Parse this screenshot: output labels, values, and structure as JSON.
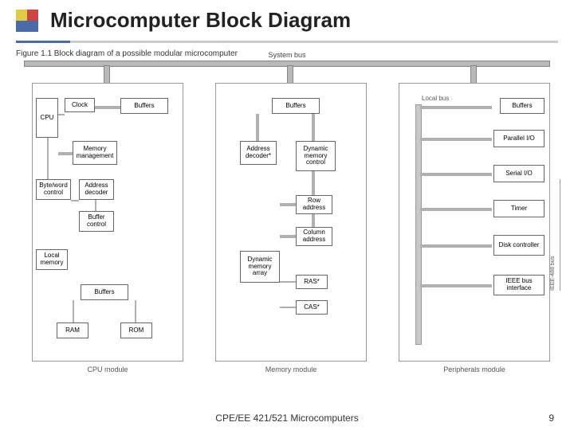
{
  "title": "Microcomputer Block Diagram",
  "figure_caption": "Figure 1.1  Block diagram of a possible modular microcomputer",
  "system_bus_label": "System bus",
  "modules": {
    "cpu": {
      "label": "CPU module",
      "blocks": {
        "cpu": "CPU",
        "clock": "Clock",
        "buffers_top": "Buffers",
        "mem_mgmt": "Memory management",
        "byteword": "Byte/word control",
        "addr_dec": "Address decoder",
        "buf_ctrl": "Buffer control",
        "local_mem": "Local memory",
        "buffers_bot": "Buffers",
        "ram": "RAM",
        "rom": "ROM"
      }
    },
    "memory": {
      "label": "Memory module",
      "blocks": {
        "buffers": "Buffers",
        "addr_dec": "Address decoder*",
        "dyn_ctrl": "Dynamic memory control",
        "row_addr": "Row address",
        "col_addr": "Column address",
        "dyn_array": "Dynamic memory array",
        "ras": "RAS*",
        "cas": "CAS*"
      }
    },
    "periph": {
      "label": "Peripherals module",
      "local_bus": "Local bus",
      "blocks": {
        "buffers": "Buffers",
        "pio": "Parallel I/O",
        "sio": "Serial I/O",
        "timer": "Timer",
        "disk": "Disk controller",
        "ieee": "IEEE bus interface",
        "ieee_side": "IEEE-488 bus"
      }
    }
  },
  "footer": "CPE/EE 421/521 Microcomputers",
  "page": "9"
}
